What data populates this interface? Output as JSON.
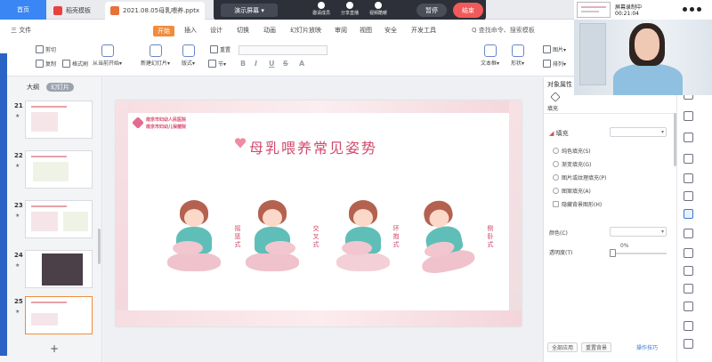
{
  "tabs": {
    "home": "首页",
    "template": "稻壳模板",
    "file": "2021.08.05母乳喂养.pptx"
  },
  "presenter": {
    "mode": "演示屏幕 ▾",
    "items": [
      "邀请成员",
      "分享直播",
      "视频酷暖"
    ],
    "pause": "暂停",
    "end": "结束"
  },
  "ribbon": {
    "menu": [
      "三 文件",
      "开始",
      "插入",
      "设计",
      "切换",
      "动画",
      "幻灯片放映",
      "审阅",
      "视图",
      "安全",
      "开发工具"
    ],
    "search": "Q 查找命令、搜索模板",
    "tools_small": [
      "剪切",
      "复制",
      "格式刷",
      "重置"
    ],
    "tools_big": [
      "从当前开始▾",
      "新建幻灯片▾",
      "版式▾",
      "节▾",
      "文本框▾",
      "形状▾",
      "图片▾",
      "排列▾"
    ],
    "format": [
      "B",
      "I",
      "U",
      "S",
      "A"
    ]
  },
  "left_panel": {
    "tabs": [
      "大纲",
      "幻灯片"
    ],
    "slides": [
      {
        "num": "21"
      },
      {
        "num": "22"
      },
      {
        "num": "23"
      },
      {
        "num": "24"
      },
      {
        "num": "25"
      }
    ]
  },
  "slide": {
    "logo_line1": "南京市妇幼人民医院",
    "logo_line2": "南京市妇幼儿保健院",
    "title": "母乳喂养常见姿势",
    "labels": [
      "摇篮式",
      "交叉式",
      "环抱式",
      "侧卧式"
    ]
  },
  "right_panel": {
    "header": "对象属性",
    "tab": "填充",
    "section": "填充",
    "options": [
      "纯色填充(S)",
      "渐变填充(G)",
      "图片或纹理填充(P)",
      "图案填充(A)"
    ],
    "checkbox": "隐藏背景图形(H)",
    "color_label": "颜色(C)",
    "transparency_label": "透明度(T)",
    "transparency_value": "0%",
    "btn_apply_all": "全部应用",
    "btn_reset": "重置背景",
    "link": "操作技巧"
  },
  "webcam": {
    "recording": "屏幕录制中",
    "time": "00:21:04"
  }
}
